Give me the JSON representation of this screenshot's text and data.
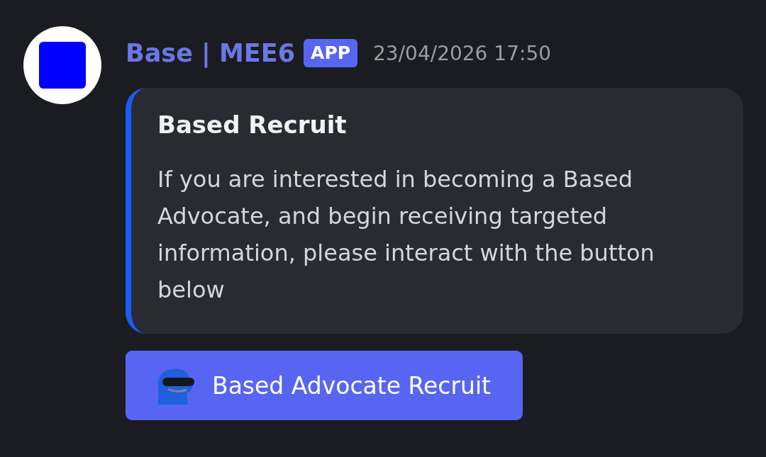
{
  "message": {
    "author": "Base | MEE6",
    "badge": "APP",
    "timestamp": "23/04/2026 17:50"
  },
  "embed": {
    "title": "Based Recruit",
    "description": "If you are interested in becoming a Based Advocate, and begin receiving targeted information, please interact with the button below"
  },
  "buttons": [
    {
      "label": "Based Advocate Recruit"
    }
  ]
}
